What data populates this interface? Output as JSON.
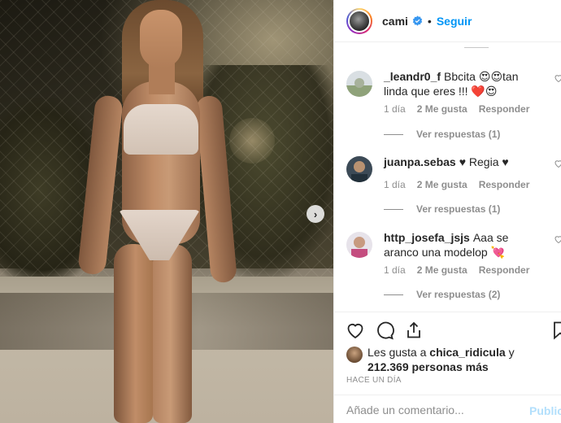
{
  "post": {
    "photo_alt": "",
    "next_icon": "chevron-right-icon"
  },
  "header": {
    "username": "cami",
    "separator": "•",
    "follow_label": "Seguir",
    "verified_icon": "verified-badge-icon"
  },
  "comments": [
    {
      "username": "_leandr0_f",
      "text": "Bbcita 😍😍tan linda que eres !!! ❤️😍",
      "age": "1 día",
      "likes": "2 Me gusta",
      "reply_label": "Responder",
      "replies_label": "Ver respuestas (1)"
    },
    {
      "username": "juanpa.sebas",
      "text": "♥ Regia ♥",
      "age": "1 día",
      "likes": "2 Me gusta",
      "reply_label": "Responder",
      "replies_label": "Ver respuestas (1)"
    },
    {
      "username": "http_josefa_jsjs",
      "text": "Aaa se aranco una modelop 💘",
      "age": "1 día",
      "likes": "2 Me gusta",
      "reply_label": "Responder",
      "replies_label": "Ver respuestas (2)"
    }
  ],
  "likes": {
    "prefix": "Les gusta a",
    "user": "chica_ridicula",
    "connector": "y",
    "count": "212.369 personas más"
  },
  "time": "HACE UN DÍA",
  "add_comment": {
    "placeholder": "Añade un comentario...",
    "publish_label": "Publicar"
  },
  "colors": {
    "accent": "#0095f6",
    "publish_disabled": "#b2dffc",
    "muted": "#8e8e8e"
  }
}
